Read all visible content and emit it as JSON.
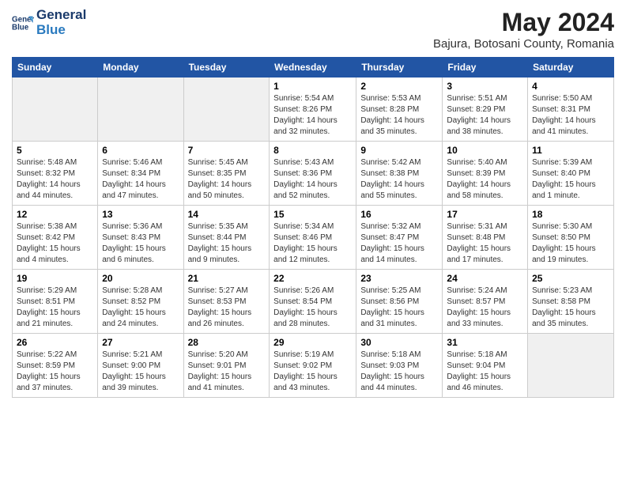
{
  "header": {
    "logo_line1": "General",
    "logo_line2": "Blue",
    "month_title": "May 2024",
    "location": "Bajura, Botosani County, Romania"
  },
  "days_of_week": [
    "Sunday",
    "Monday",
    "Tuesday",
    "Wednesday",
    "Thursday",
    "Friday",
    "Saturday"
  ],
  "weeks": [
    [
      {
        "day": "",
        "empty": true
      },
      {
        "day": "",
        "empty": true
      },
      {
        "day": "",
        "empty": true
      },
      {
        "day": "1",
        "sunrise": "5:54 AM",
        "sunset": "8:26 PM",
        "daylight": "14 hours and 32 minutes."
      },
      {
        "day": "2",
        "sunrise": "5:53 AM",
        "sunset": "8:28 PM",
        "daylight": "14 hours and 35 minutes."
      },
      {
        "day": "3",
        "sunrise": "5:51 AM",
        "sunset": "8:29 PM",
        "daylight": "14 hours and 38 minutes."
      },
      {
        "day": "4",
        "sunrise": "5:50 AM",
        "sunset": "8:31 PM",
        "daylight": "14 hours and 41 minutes."
      }
    ],
    [
      {
        "day": "5",
        "sunrise": "5:48 AM",
        "sunset": "8:32 PM",
        "daylight": "14 hours and 44 minutes."
      },
      {
        "day": "6",
        "sunrise": "5:46 AM",
        "sunset": "8:34 PM",
        "daylight": "14 hours and 47 minutes."
      },
      {
        "day": "7",
        "sunrise": "5:45 AM",
        "sunset": "8:35 PM",
        "daylight": "14 hours and 50 minutes."
      },
      {
        "day": "8",
        "sunrise": "5:43 AM",
        "sunset": "8:36 PM",
        "daylight": "14 hours and 52 minutes."
      },
      {
        "day": "9",
        "sunrise": "5:42 AM",
        "sunset": "8:38 PM",
        "daylight": "14 hours and 55 minutes."
      },
      {
        "day": "10",
        "sunrise": "5:40 AM",
        "sunset": "8:39 PM",
        "daylight": "14 hours and 58 minutes."
      },
      {
        "day": "11",
        "sunrise": "5:39 AM",
        "sunset": "8:40 PM",
        "daylight": "15 hours and 1 minute."
      }
    ],
    [
      {
        "day": "12",
        "sunrise": "5:38 AM",
        "sunset": "8:42 PM",
        "daylight": "15 hours and 4 minutes."
      },
      {
        "day": "13",
        "sunrise": "5:36 AM",
        "sunset": "8:43 PM",
        "daylight": "15 hours and 6 minutes."
      },
      {
        "day": "14",
        "sunrise": "5:35 AM",
        "sunset": "8:44 PM",
        "daylight": "15 hours and 9 minutes."
      },
      {
        "day": "15",
        "sunrise": "5:34 AM",
        "sunset": "8:46 PM",
        "daylight": "15 hours and 12 minutes."
      },
      {
        "day": "16",
        "sunrise": "5:32 AM",
        "sunset": "8:47 PM",
        "daylight": "15 hours and 14 minutes."
      },
      {
        "day": "17",
        "sunrise": "5:31 AM",
        "sunset": "8:48 PM",
        "daylight": "15 hours and 17 minutes."
      },
      {
        "day": "18",
        "sunrise": "5:30 AM",
        "sunset": "8:50 PM",
        "daylight": "15 hours and 19 minutes."
      }
    ],
    [
      {
        "day": "19",
        "sunrise": "5:29 AM",
        "sunset": "8:51 PM",
        "daylight": "15 hours and 21 minutes."
      },
      {
        "day": "20",
        "sunrise": "5:28 AM",
        "sunset": "8:52 PM",
        "daylight": "15 hours and 24 minutes."
      },
      {
        "day": "21",
        "sunrise": "5:27 AM",
        "sunset": "8:53 PM",
        "daylight": "15 hours and 26 minutes."
      },
      {
        "day": "22",
        "sunrise": "5:26 AM",
        "sunset": "8:54 PM",
        "daylight": "15 hours and 28 minutes."
      },
      {
        "day": "23",
        "sunrise": "5:25 AM",
        "sunset": "8:56 PM",
        "daylight": "15 hours and 31 minutes."
      },
      {
        "day": "24",
        "sunrise": "5:24 AM",
        "sunset": "8:57 PM",
        "daylight": "15 hours and 33 minutes."
      },
      {
        "day": "25",
        "sunrise": "5:23 AM",
        "sunset": "8:58 PM",
        "daylight": "15 hours and 35 minutes."
      }
    ],
    [
      {
        "day": "26",
        "sunrise": "5:22 AM",
        "sunset": "8:59 PM",
        "daylight": "15 hours and 37 minutes."
      },
      {
        "day": "27",
        "sunrise": "5:21 AM",
        "sunset": "9:00 PM",
        "daylight": "15 hours and 39 minutes."
      },
      {
        "day": "28",
        "sunrise": "5:20 AM",
        "sunset": "9:01 PM",
        "daylight": "15 hours and 41 minutes."
      },
      {
        "day": "29",
        "sunrise": "5:19 AM",
        "sunset": "9:02 PM",
        "daylight": "15 hours and 43 minutes."
      },
      {
        "day": "30",
        "sunrise": "5:18 AM",
        "sunset": "9:03 PM",
        "daylight": "15 hours and 44 minutes."
      },
      {
        "day": "31",
        "sunrise": "5:18 AM",
        "sunset": "9:04 PM",
        "daylight": "15 hours and 46 minutes."
      },
      {
        "day": "",
        "empty": true
      }
    ]
  ]
}
